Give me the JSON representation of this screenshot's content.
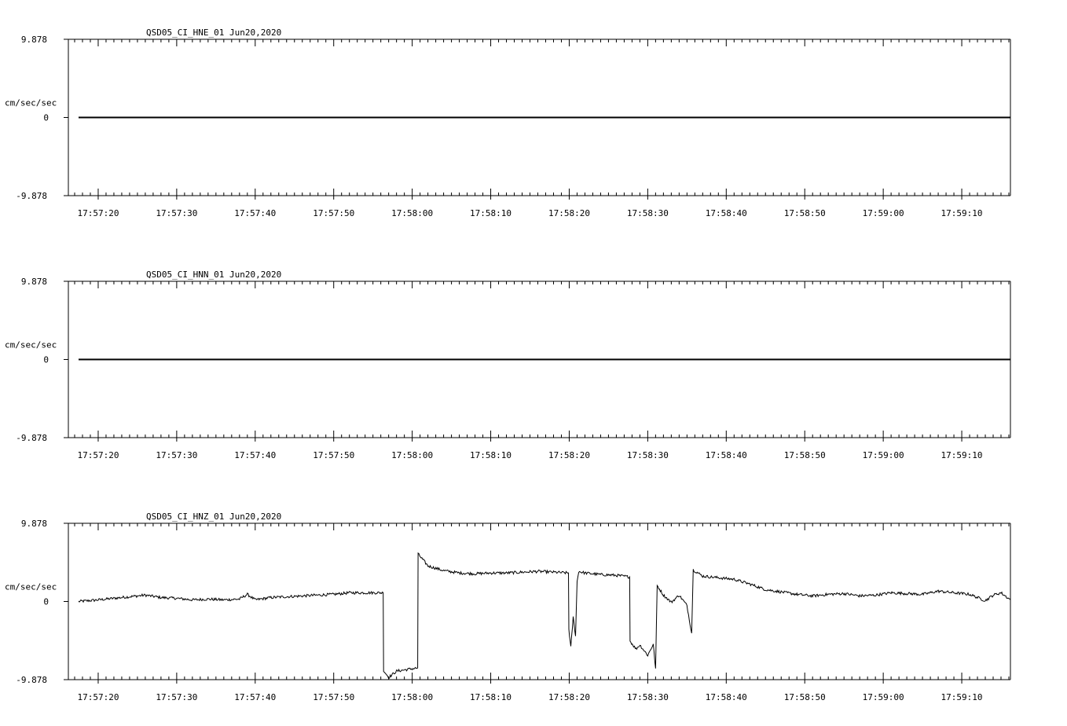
{
  "chart_data": [
    {
      "type": "line",
      "title": "QSD05_CI_HNE_01  Jun20,2020",
      "ylabel": "cm/sec/sec",
      "ylim": [
        -9.878,
        9.878
      ],
      "y_ticks": [
        "9.878",
        "0",
        "-9.878"
      ],
      "x_ticks": [
        "17:57:20",
        "17:57:30",
        "17:57:40",
        "17:57:50",
        "17:58:00",
        "17:58:10",
        "17:58:20",
        "17:58:30",
        "17:58:40",
        "17:58:50",
        "17:59:00",
        "17:59:10"
      ],
      "xlim_seconds": [
        -3.8,
        116.2
      ],
      "series": [
        {
          "points": [
            [
              -2.5,
              0
            ],
            [
              116.2,
              0
            ]
          ]
        }
      ]
    },
    {
      "type": "line",
      "title": "QSD05_CI_HNN_01  Jun20,2020",
      "ylabel": "cm/sec/sec",
      "ylim": [
        -9.878,
        9.878
      ],
      "y_ticks": [
        "9.878",
        "0",
        "-9.878"
      ],
      "x_ticks": [
        "17:57:20",
        "17:57:30",
        "17:57:40",
        "17:57:50",
        "17:58:00",
        "17:58:10",
        "17:58:20",
        "17:58:30",
        "17:58:40",
        "17:58:50",
        "17:59:00",
        "17:59:10"
      ],
      "xlim_seconds": [
        -3.8,
        116.2
      ],
      "series": [
        {
          "points": [
            [
              -2.5,
              0
            ],
            [
              116.2,
              0
            ]
          ]
        }
      ]
    },
    {
      "type": "line",
      "title": "QSD05_CI_HNZ_01  Jun20,2020",
      "ylabel": "cm/sec/sec",
      "ylim": [
        -9.878,
        9.878
      ],
      "y_ticks": [
        "9.878",
        "0",
        "-9.878"
      ],
      "x_ticks": [
        "17:57:20",
        "17:57:30",
        "17:57:40",
        "17:57:50",
        "17:58:00",
        "17:58:10",
        "17:58:20",
        "17:58:30",
        "17:58:40",
        "17:58:50",
        "17:59:00",
        "17:59:10"
      ],
      "xlim_seconds": [
        -3.8,
        116.2
      ],
      "series": [
        {
          "points": [
            [
              -2.5,
              0.0
            ],
            [
              0,
              0.2
            ],
            [
              2,
              0.4
            ],
            [
              4,
              0.6
            ],
            [
              6,
              0.8
            ],
            [
              8,
              0.5
            ],
            [
              10,
              0.4
            ],
            [
              12,
              0.2
            ],
            [
              14,
              0.3
            ],
            [
              16,
              0.2
            ],
            [
              18,
              0.3
            ],
            [
              19,
              0.9
            ],
            [
              20,
              0.2
            ],
            [
              22,
              0.5
            ],
            [
              24,
              0.6
            ],
            [
              26,
              0.7
            ],
            [
              28,
              0.8
            ],
            [
              30,
              0.9
            ],
            [
              32,
              1.1
            ],
            [
              34,
              1.1
            ],
            [
              36.3,
              1.1
            ],
            [
              36.35,
              -8.7
            ],
            [
              37,
              -9.6
            ],
            [
              38,
              -8.8
            ],
            [
              40,
              -8.5
            ],
            [
              40.7,
              -8.4
            ],
            [
              40.75,
              6.0
            ],
            [
              42,
              4.5
            ],
            [
              44,
              3.9
            ],
            [
              46,
              3.6
            ],
            [
              48,
              3.5
            ],
            [
              50,
              3.6
            ],
            [
              52,
              3.6
            ],
            [
              54,
              3.7
            ],
            [
              56,
              3.8
            ],
            [
              58,
              3.7
            ],
            [
              59.9,
              3.6
            ],
            [
              59.95,
              -3.5
            ],
            [
              60.2,
              -5.8
            ],
            [
              60.5,
              -2.0
            ],
            [
              60.8,
              -4.3
            ],
            [
              61.0,
              2.5
            ],
            [
              61.2,
              3.8
            ],
            [
              62,
              3.6
            ],
            [
              64,
              3.4
            ],
            [
              66,
              3.3
            ],
            [
              67.7,
              3.1
            ],
            [
              67.75,
              -5.0
            ],
            [
              68.5,
              -6.0
            ],
            [
              69,
              -5.5
            ],
            [
              70,
              -6.8
            ],
            [
              70.7,
              -5.4
            ],
            [
              71.0,
              -8.5
            ],
            [
              71.2,
              2.0
            ],
            [
              72,
              0.8
            ],
            [
              73,
              -0.1
            ],
            [
              74,
              0.8
            ],
            [
              75,
              -0.5
            ],
            [
              75.6,
              -4.0
            ],
            [
              75.8,
              4.0
            ],
            [
              77,
              3.2
            ],
            [
              79,
              3.0
            ],
            [
              81,
              2.8
            ],
            [
              83,
              2.2
            ],
            [
              85,
              1.5
            ],
            [
              87,
              1.2
            ],
            [
              89,
              0.9
            ],
            [
              91,
              0.7
            ],
            [
              93,
              0.9
            ],
            [
              95,
              1.0
            ],
            [
              97,
              0.7
            ],
            [
              99,
              0.8
            ],
            [
              101,
              1.1
            ],
            [
              103,
              1.0
            ],
            [
              105,
              0.9
            ],
            [
              107,
              1.3
            ],
            [
              109,
              1.1
            ],
            [
              111,
              0.9
            ],
            [
              113,
              0.1
            ],
            [
              114,
              0.8
            ],
            [
              115,
              1.1
            ],
            [
              116.2,
              0.2
            ]
          ]
        }
      ]
    }
  ]
}
